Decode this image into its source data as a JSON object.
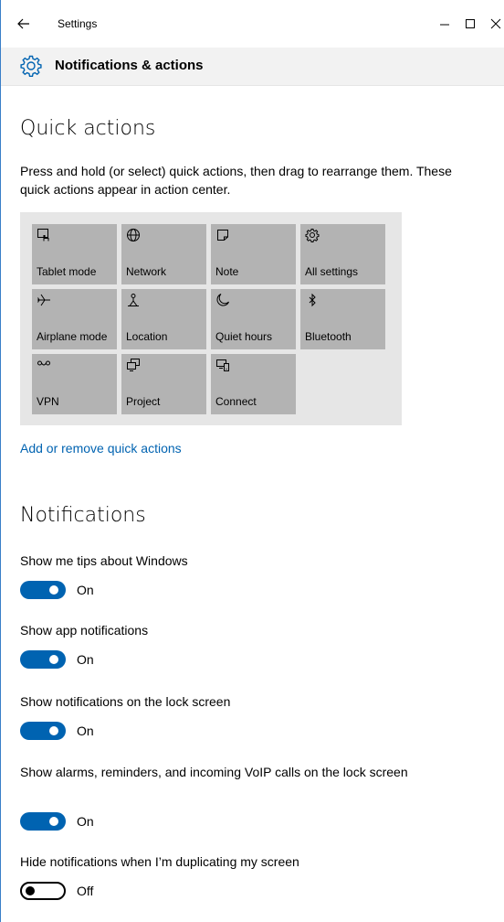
{
  "window": {
    "title": "Settings",
    "controls": [
      "minimize",
      "maximize",
      "close"
    ]
  },
  "header": {
    "title": "Notifications & actions",
    "icon": "gear-icon"
  },
  "quick_actions": {
    "title": "Quick actions",
    "description": "Press and hold (or select) quick actions, then drag to rearrange them. These quick actions appear in action center.",
    "tiles": [
      {
        "label": "Tablet mode",
        "icon": "tablet-mode-icon"
      },
      {
        "label": "Network",
        "icon": "globe-icon"
      },
      {
        "label": "Note",
        "icon": "note-icon"
      },
      {
        "label": "All settings",
        "icon": "gear-icon"
      },
      {
        "label": "Airplane mode",
        "icon": "airplane-icon"
      },
      {
        "label": "Location",
        "icon": "location-icon"
      },
      {
        "label": "Quiet hours",
        "icon": "moon-icon"
      },
      {
        "label": "Bluetooth",
        "icon": "bluetooth-icon"
      },
      {
        "label": "VPN",
        "icon": "vpn-icon"
      },
      {
        "label": "Project",
        "icon": "project-icon"
      },
      {
        "label": "Connect",
        "icon": "connect-icon"
      }
    ],
    "add_remove_link": "Add or remove quick actions"
  },
  "notifications": {
    "title": "Notifications",
    "settings": [
      {
        "label": "Show me tips about Windows",
        "state": "On",
        "on": true
      },
      {
        "label": "Show app notifications",
        "state": "On",
        "on": true
      },
      {
        "label": "Show notifications on the lock screen",
        "state": "On",
        "on": true
      },
      {
        "label": "Show alarms, reminders, and incoming VoIP calls on the lock screen",
        "state": "On",
        "on": true
      },
      {
        "label": "Hide notifications when I’m duplicating my screen",
        "state": "Off",
        "on": false
      }
    ]
  },
  "colors": {
    "accent": "#0063b1",
    "tile": "#b3b3b3",
    "panel": "#e6e6e6",
    "header": "#f2f2f2"
  }
}
